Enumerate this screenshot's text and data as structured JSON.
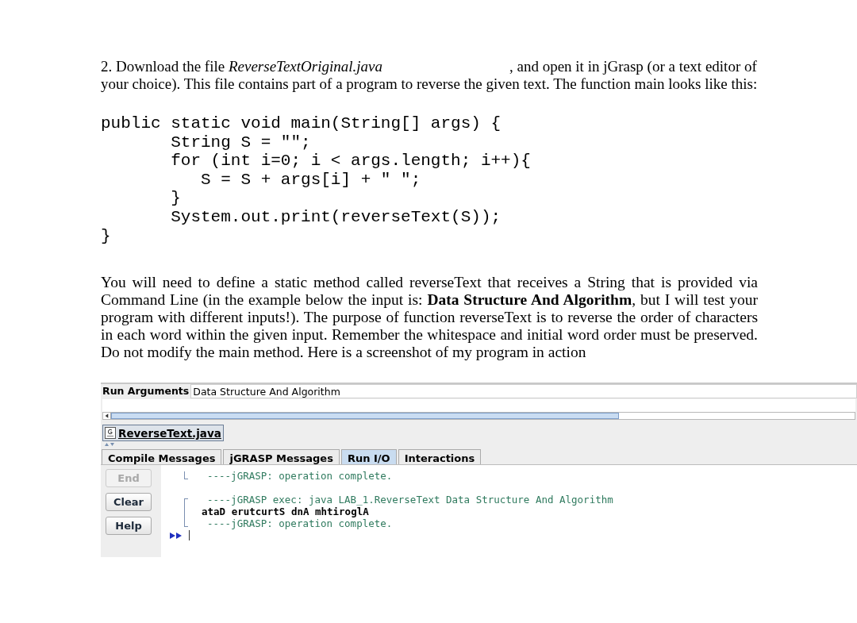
{
  "intro": {
    "text": "2. Download the file *ReverseTextOriginal.java*",
    "rest": ", and open it in jGrasp (or a text editor of your choice). This file contains part of a program to reverse the given text. The function main looks like this:"
  },
  "code": [
    "public static void main(String[] args) {",
    "       String S = \"\";",
    "       for (int i=0; i < args.length; i++){",
    "          S = S + args[i] + \" \";",
    "       }",
    "       System.out.print(reverseText(S));",
    "}"
  ],
  "description": "You will need to define a static method called reverseText that receives a String that is provided via Command Line (in the example below the input is: **Data Structure And Algorithm**, but I will test your program with different inputs!). The purpose of function reverseText is to reverse the order of characters in each word within the given input. Remember the whitespace and initial word order must be preserved. Do not modify the main method. Here is a screenshot of my program in action",
  "jgrasp": {
    "run_arguments": {
      "label": "Run Arguments",
      "value": "Data Structure And Algorithm"
    },
    "file_tab": "ReverseText.java",
    "tabs": [
      {
        "label": "Compile Messages",
        "selected": false
      },
      {
        "label": "jGRASP Messages",
        "selected": false
      },
      {
        "label": "Run I/O",
        "selected": true
      },
      {
        "label": "Interactions",
        "selected": false
      }
    ],
    "buttons": [
      {
        "label": "End",
        "disabled": true
      },
      {
        "label": "Clear",
        "disabled": false
      },
      {
        "label": "Help",
        "disabled": false
      }
    ],
    "output_blocks": [
      {
        "cut_top": true,
        "lines": [
          {
            "kind": "status",
            "text": "----jGRASP: operation complete."
          }
        ]
      },
      {
        "cut_top": false,
        "lines": [
          {
            "kind": "status",
            "text": "----jGRASP exec: java LAB_1.ReverseText Data Structure And Algorithm"
          },
          {
            "kind": "output",
            "text": "ataD erutcurtS dnA mhtiroglA"
          },
          {
            "kind": "status",
            "text": "----jGRASP: operation complete."
          }
        ]
      }
    ]
  }
}
